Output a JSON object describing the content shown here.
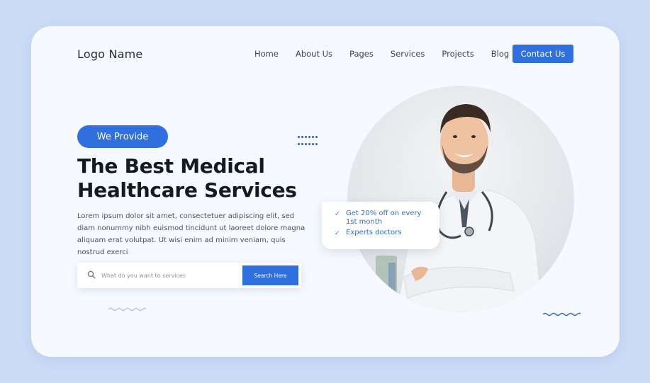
{
  "header": {
    "logo": "Logo Name",
    "nav": [
      "Home",
      "About Us",
      "Pages",
      "Services",
      "Projects",
      "Blog"
    ],
    "cta": "Contact Us"
  },
  "hero": {
    "badge": "We Provide",
    "title_line1": "The Best Medical",
    "title_line2": "Healthcare Services",
    "description": "Lorem ipsum dolor sit amet, consectetuer adipiscing elit, sed diam nonummy nibh euismod tincidunt ut laoreet dolore magna aliquam erat volutpat. Ut wisi enim ad minim veniam, quis nostrud exerci"
  },
  "search": {
    "icon": "search-icon",
    "placeholder": "What do you want to services",
    "button": "Search Here"
  },
  "benefits": [
    {
      "icon": "check-icon",
      "text": "Get 20% off on every 1st month"
    },
    {
      "icon": "check-icon",
      "text": "Experts doctors"
    }
  ],
  "colors": {
    "accent": "#2f6fde",
    "page_bg": "#cbdcf7",
    "card_bg": "#f6f9fe",
    "heading": "#141a22"
  }
}
